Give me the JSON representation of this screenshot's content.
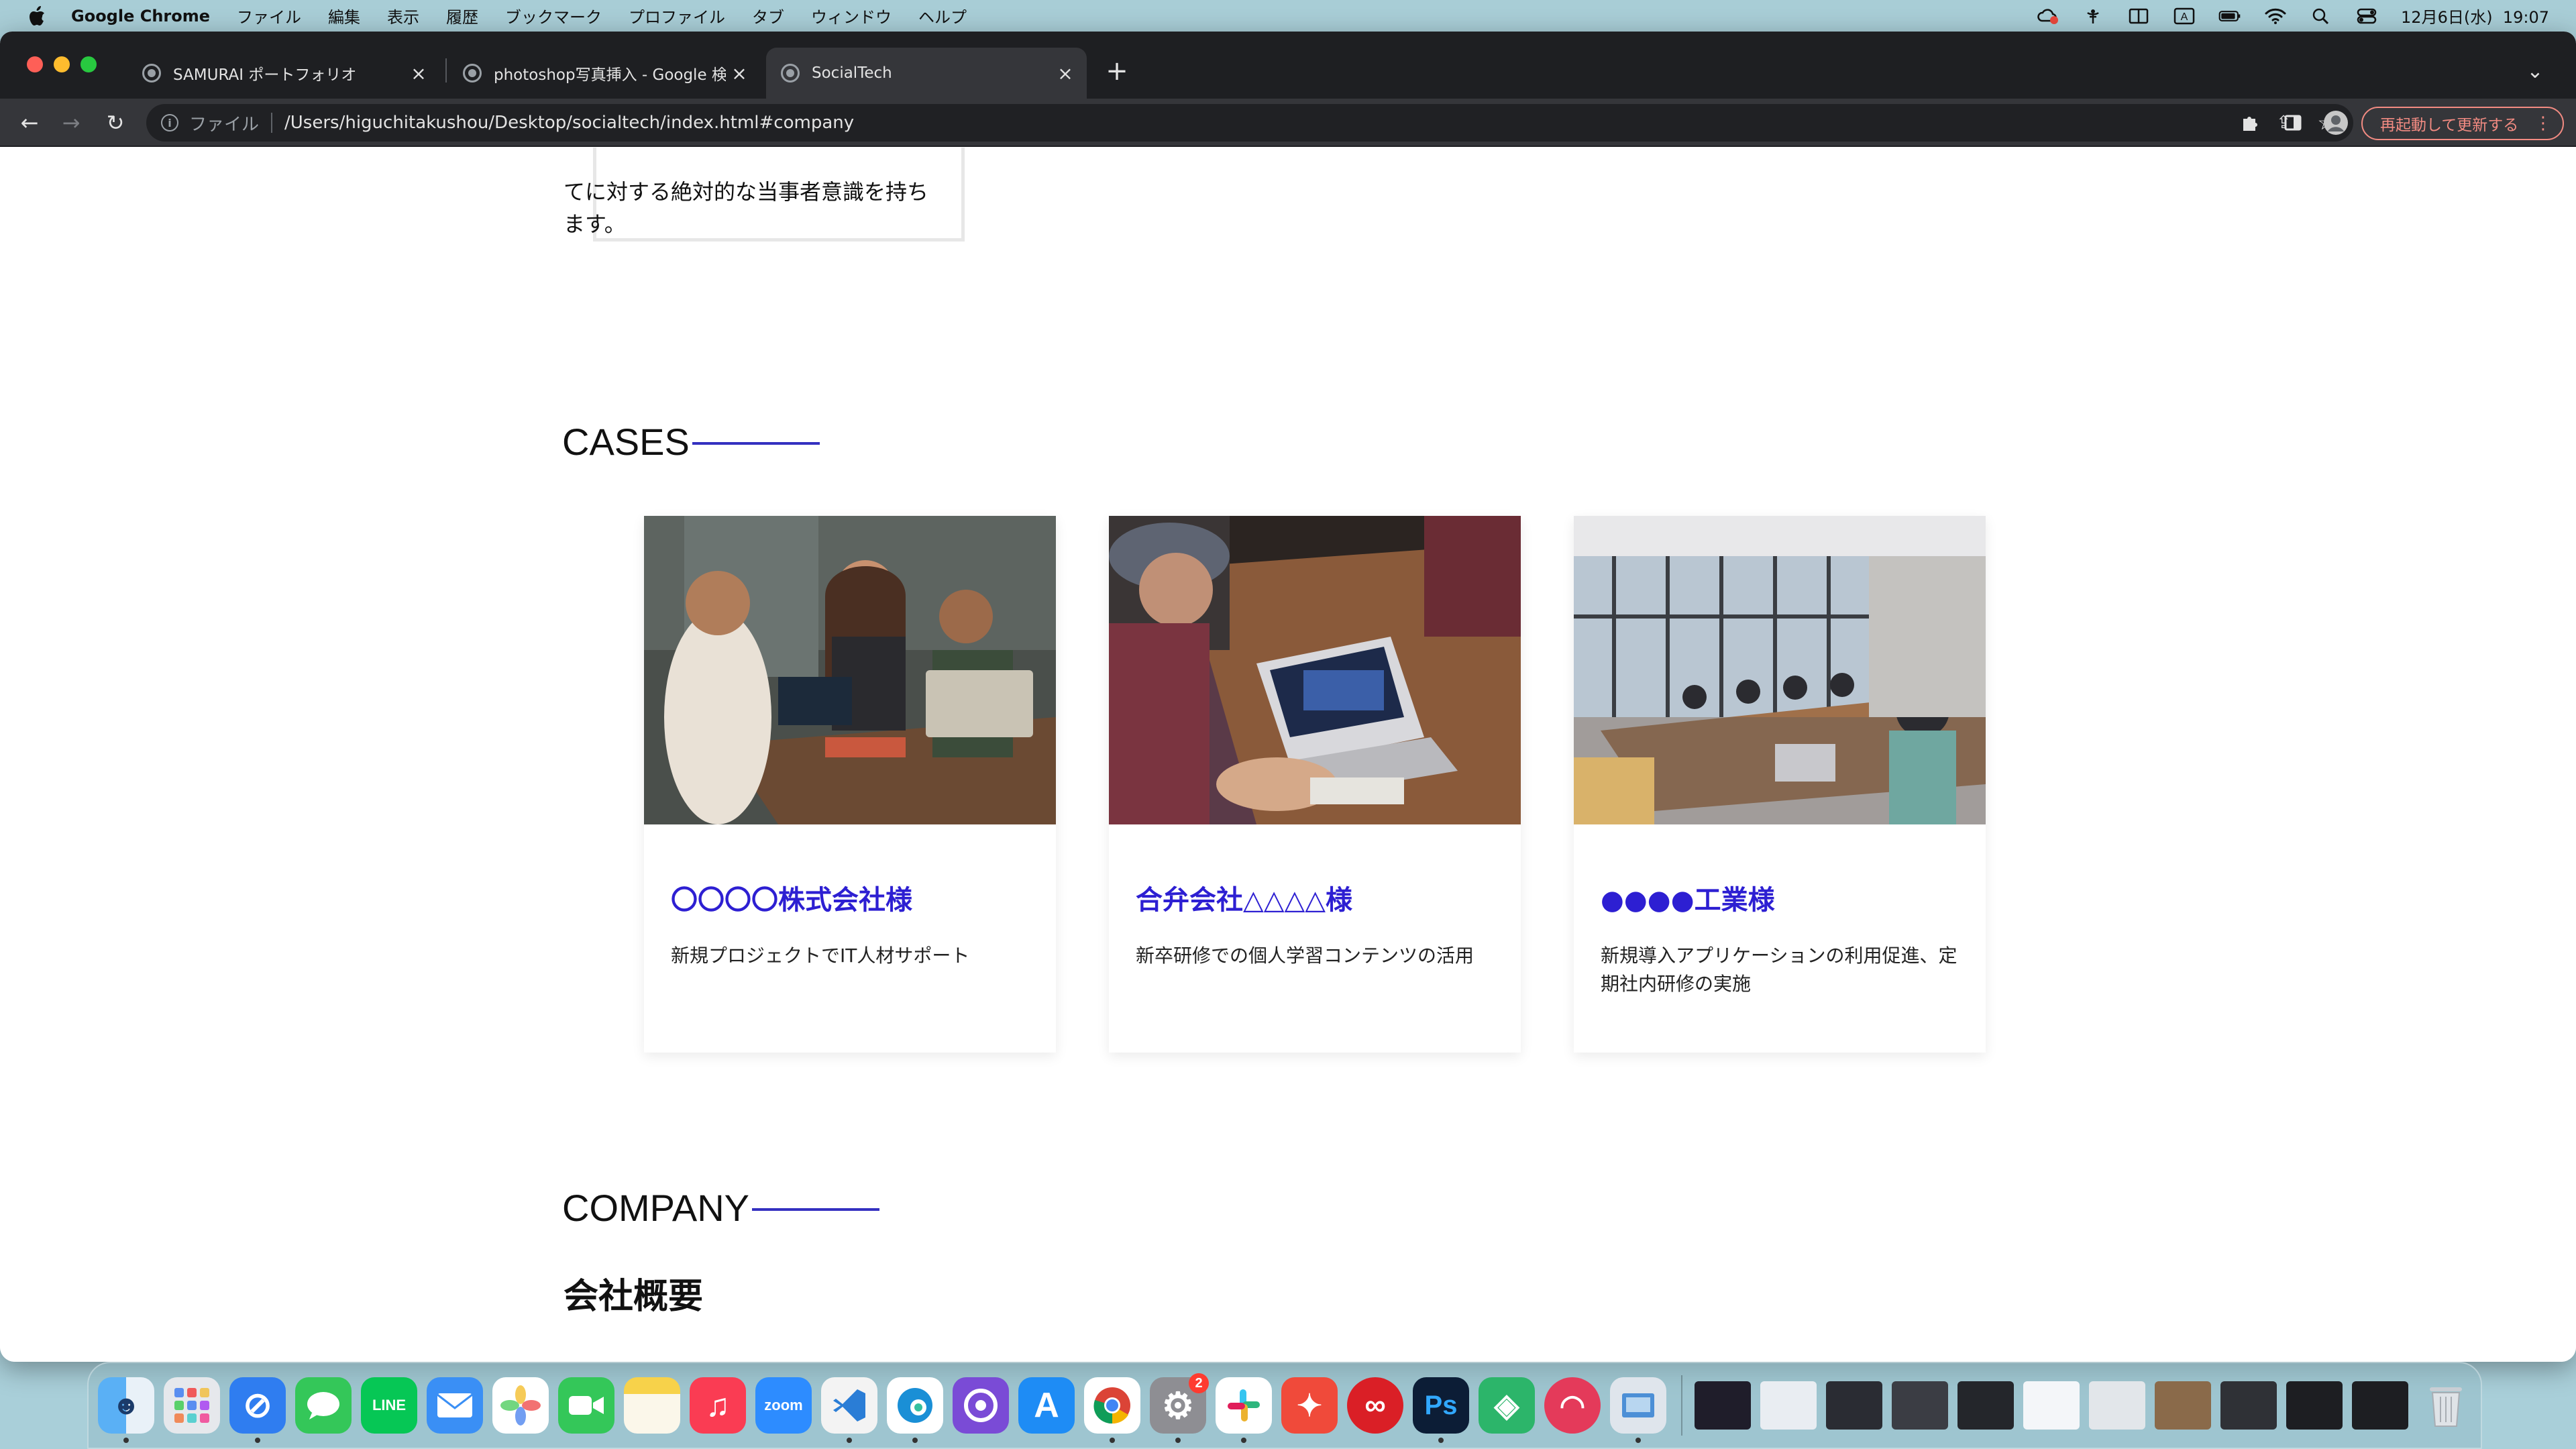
{
  "menubar": {
    "app_name": "Google Chrome",
    "menus": [
      "ファイル",
      "編集",
      "表示",
      "履歴",
      "ブックマーク",
      "プロファイル",
      "タブ",
      "ウィンドウ",
      "ヘルプ"
    ],
    "input_indicator": "A",
    "datetime": "12月6日(水)  19:07"
  },
  "browser": {
    "tabs": [
      {
        "title": "SAMURAI ポートフォリオ",
        "active": false
      },
      {
        "title": "photoshop写真挿入 - Google 検",
        "active": false
      },
      {
        "title": "SocialTech",
        "active": true
      }
    ],
    "address": {
      "scheme_label": "ファイル",
      "url": "/Users/higuchitakushou/Desktop/socialtech/index.html#company"
    },
    "update_button_label": "再起動して更新する"
  },
  "page": {
    "about_text_fragment": "てに対する絶対的な当事者意識を持ちます。",
    "cases": {
      "title": "CASES",
      "items": [
        {
          "title": "〇〇〇〇株式会社様",
          "desc": "新規プロジェクトでIT人材サポート",
          "photo": "meeting-photo"
        },
        {
          "title": "合弁会社△△△△様",
          "desc": "新卒研修での個人学習コンテンツの活用",
          "photo": "laptop-photo"
        },
        {
          "title": "●●●●工業様",
          "desc": "新規導入アプリケーションの利用促進、定期社内研修の実施",
          "photo": "conference-photo"
        }
      ]
    },
    "company": {
      "title": "COMPANY",
      "subtitle": "会社概要"
    }
  },
  "dock": {
    "apps": [
      "Finder",
      "Launchpad",
      "Safari",
      "Messages",
      "LINE",
      "Mail",
      "Photos",
      "FaceTime",
      "Notes",
      "Music",
      "zoom",
      "Visual Studio Code",
      "Edge",
      "GitHub Desktop",
      "App Store",
      "Chrome",
      "System Settings",
      "Slack",
      "Scrapbox",
      "Adobe Creative Cloud",
      "Ps",
      "Affinity",
      "Kiss",
      "Preview"
    ],
    "settings_badge": "2",
    "zoom_label": "zoom",
    "ps_label": "Ps"
  },
  "colors": {
    "accent": "#2d1fd2",
    "accent_line": "#3430c0"
  }
}
